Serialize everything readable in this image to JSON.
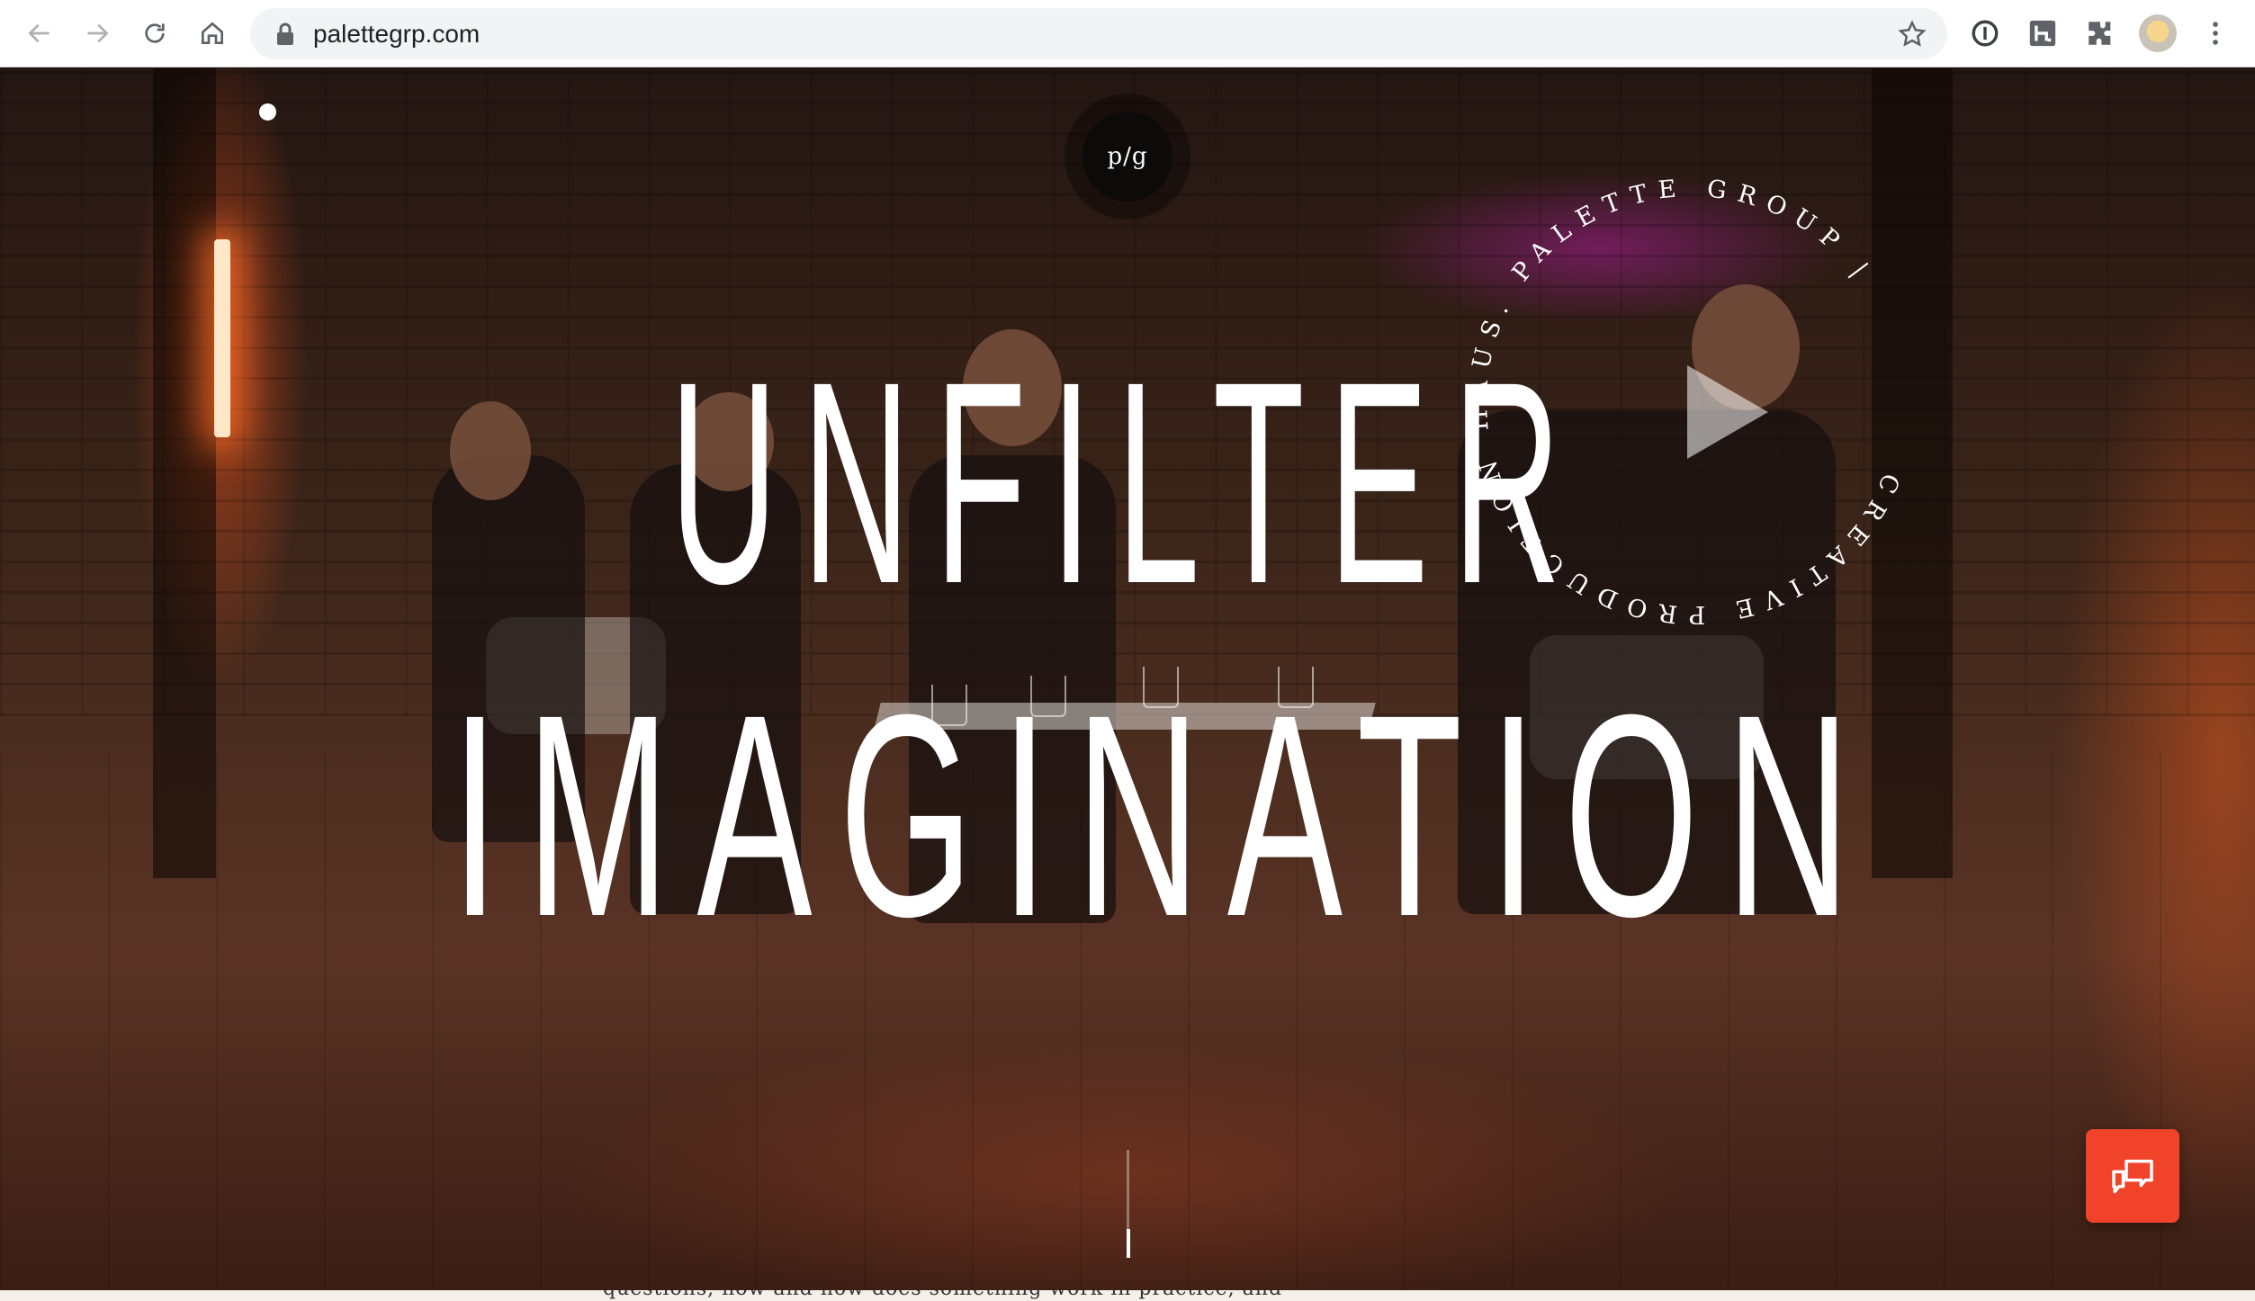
{
  "browser": {
    "url": "palettegrp.com",
    "back_icon": "arrow-left-icon",
    "forward_icon": "arrow-right-icon",
    "reload_icon": "reload-icon",
    "home_icon": "home-icon",
    "lock_icon": "lock-icon",
    "bookmark_icon": "star-icon",
    "extensions": [
      "password-manager-icon",
      "hunter-extension-icon",
      "puzzle-extensions-icon"
    ],
    "avatar_icon": "profile-avatar-icon",
    "menu_icon": "kebab-menu-icon"
  },
  "hero": {
    "logo_text": "p/g",
    "headline_line1": "UNFILTER",
    "headline_line2": "IMAGINATION",
    "circle_text": "CREATIVE PRODUCTION HAUS. PALETTE GROUP | ",
    "play_icon": "play-icon",
    "chat_icon": "chat-bubbles-icon",
    "accent_color": "#f0432a"
  },
  "below_fold_peek": "questions, how and how does something work in practice, and"
}
